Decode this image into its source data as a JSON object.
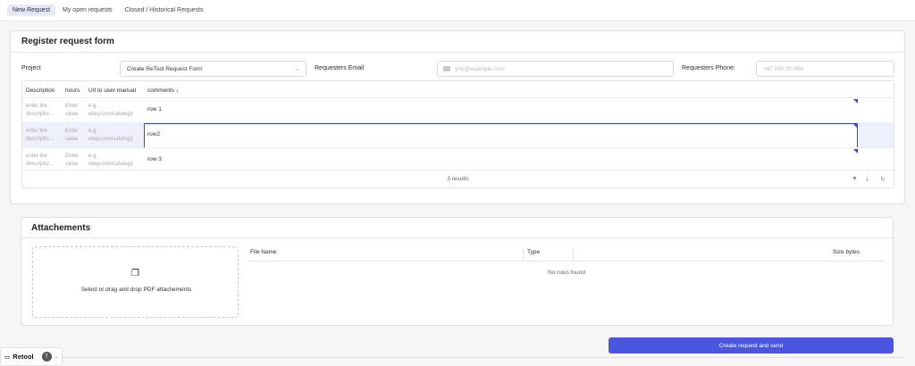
{
  "tabs": [
    {
      "label": "New Request",
      "active": true
    },
    {
      "label": "My open requests",
      "active": false
    },
    {
      "label": "Closed / Historical Requests",
      "active": false
    }
  ],
  "form": {
    "title": "Register request form",
    "project_label": "Project",
    "project_value": "Create ReTool Request Form",
    "email_label": "Requesters Email",
    "email_placeholder": "you@example.com",
    "phone_label": "Requesters Phone:",
    "phone_placeholder": "+47 000 00 000"
  },
  "table": {
    "columns": [
      "Description",
      "hours",
      "Url to user manual",
      "comments ↓"
    ],
    "rows": [
      {
        "description": "enter the descriptio...",
        "hours": "Enter value",
        "url": "e.g. ebay.com/catalog/j",
        "comments": "row 1"
      },
      {
        "description": "enter the descriptio...",
        "hours": "Enter value",
        "url": "e.g. ebay.com/catalog/j",
        "comments": "row2"
      },
      {
        "description": "enter the descriptio...",
        "hours": "Enter value",
        "url": "e.g. ebay.com/catalog/j",
        "comments": "row 3"
      }
    ],
    "results": "3 results"
  },
  "attachments": {
    "title": "Attachements",
    "drop_text": "Select or drag and drop PDF attachements",
    "columns": [
      "File Name",
      "Type",
      "Size bytes"
    ],
    "empty": "No rows found"
  },
  "submit_label": "Create request and send",
  "retool": {
    "name": "Retool",
    "avatar": "T"
  },
  "colors": {
    "accent": "#4b56e0",
    "selected_row": "#eef0fb",
    "active_tab": "#e6e9f9"
  }
}
